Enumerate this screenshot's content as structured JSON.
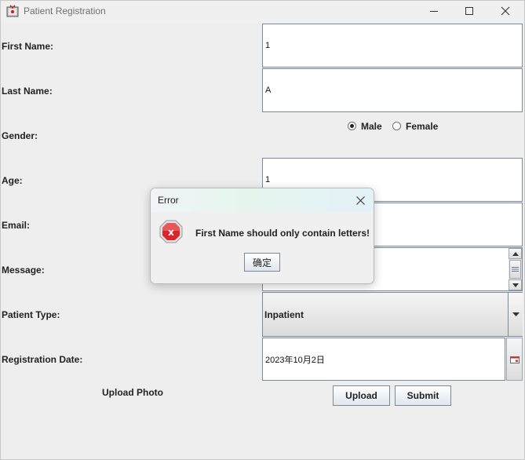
{
  "window": {
    "title": "Patient Registration",
    "minimize_icon": "minimize-icon",
    "maximize_icon": "maximize-icon",
    "close_icon": "close-icon"
  },
  "form": {
    "first_name_label": "First Name:",
    "first_name_value": "1",
    "last_name_label": "Last Name:",
    "last_name_value": "A",
    "gender_label": "Gender:",
    "gender_options": [
      "Male",
      "Female"
    ],
    "gender_selected": "Male",
    "age_label": "Age:",
    "age_value": "1",
    "email_label": "Email:",
    "email_value": "",
    "message_label": "Message:",
    "message_value": "",
    "patient_type_label": "Patient Type:",
    "patient_type_value": "Inpatient",
    "registration_date_label": "Registration Date:",
    "registration_date_value": "2023年10月2日",
    "upload_photo_label": "Upload Photo",
    "upload_button": "Upload",
    "submit_button": "Submit"
  },
  "dialog": {
    "title": "Error",
    "message": "First Name should only contain letters!",
    "ok_button": "确定",
    "icon": "error-icon"
  },
  "colors": {
    "error_red": "#d9262b",
    "field_border": "#7a8a99",
    "background": "#eeeeee"
  }
}
